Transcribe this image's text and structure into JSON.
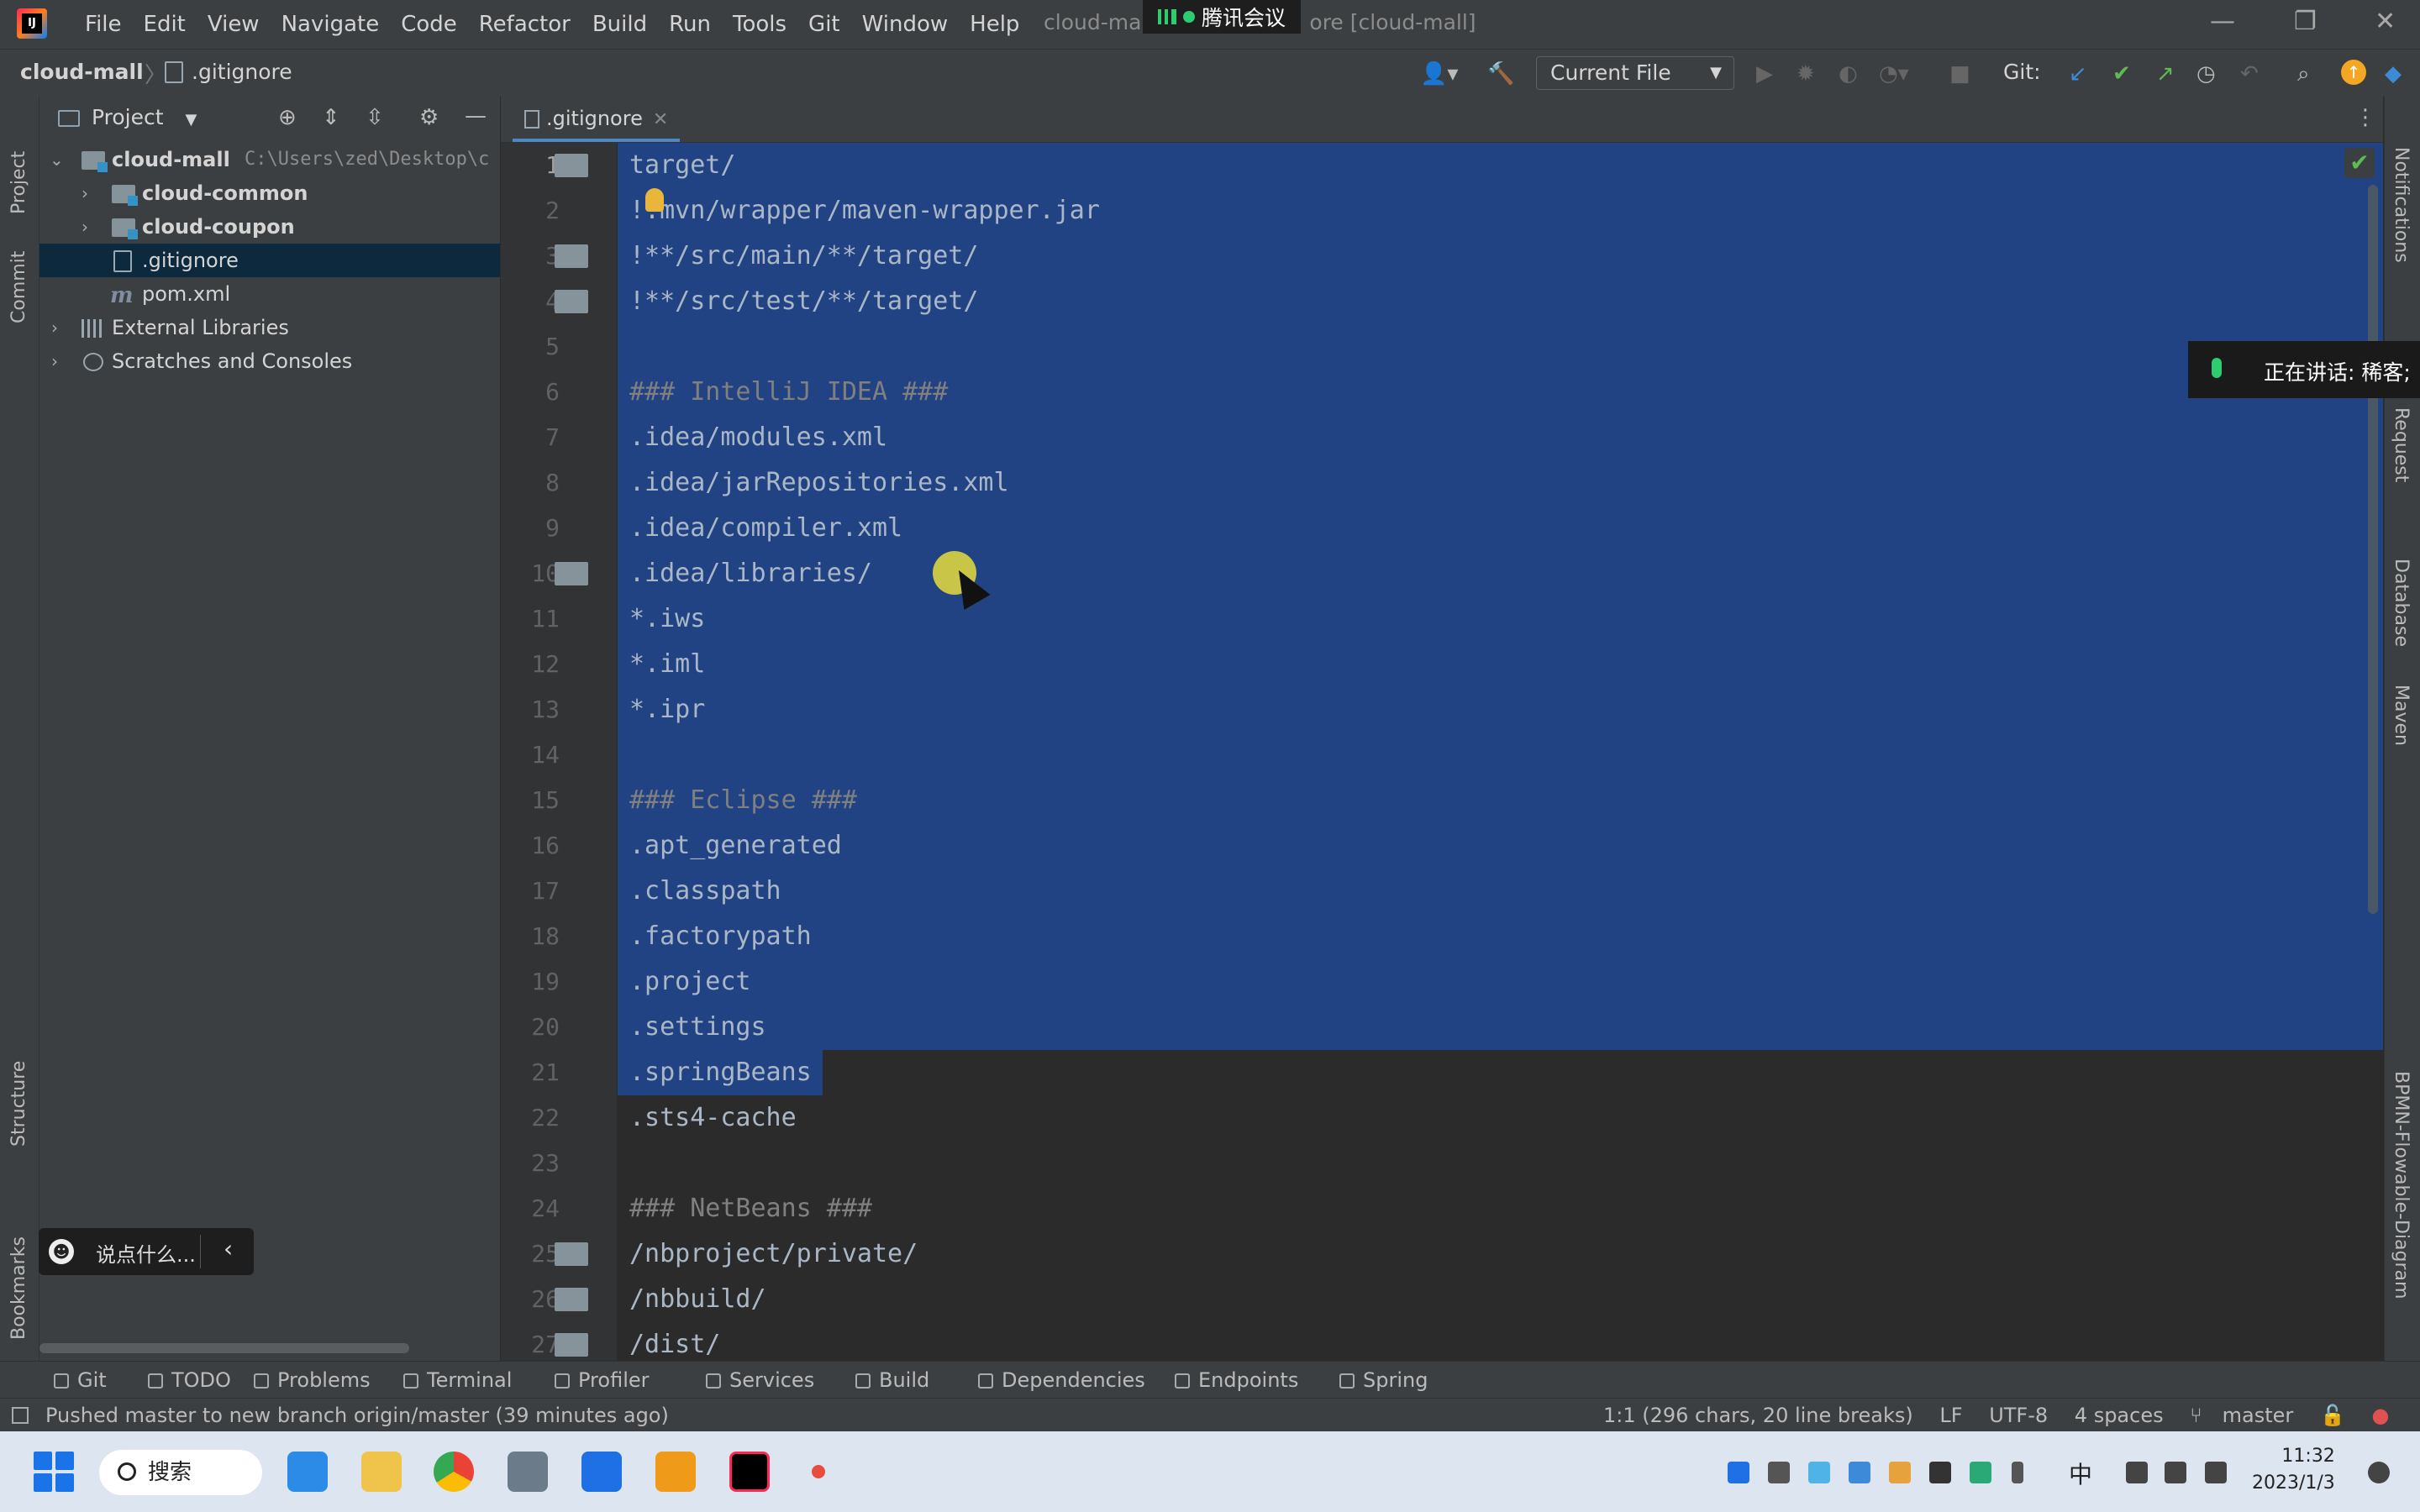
{
  "window": {
    "title": "cloud-ma",
    "title_tail": "ore [cloud-mall]",
    "meeting_label": "腾讯会议",
    "menu": [
      "File",
      "Edit",
      "View",
      "Navigate",
      "Code",
      "Refactor",
      "Build",
      "Run",
      "Tools",
      "Git",
      "Window",
      "Help"
    ]
  },
  "navbar": {
    "project": "cloud-mall",
    "file": ".gitignore",
    "run_config": "Current File",
    "git_label": "Git:"
  },
  "left_strip": [
    "Project",
    "Commit",
    "Structure",
    "Bookmarks"
  ],
  "right_strip": [
    "Notifications",
    "Request",
    "Database",
    "Maven",
    "BPMN-Flowable-Diagram"
  ],
  "project_panel": {
    "title": "Project",
    "tree": [
      {
        "label": "cloud-mall",
        "extra": "C:\\Users\\zed\\Desktop\\c",
        "type": "module",
        "expanded": true
      },
      {
        "label": "cloud-common",
        "type": "module",
        "expanded": false
      },
      {
        "label": "cloud-coupon",
        "type": "module",
        "expanded": false
      },
      {
        "label": ".gitignore",
        "type": "file",
        "selected": true
      },
      {
        "label": "pom.xml",
        "type": "maven"
      },
      {
        "label": "External Libraries",
        "type": "lib"
      },
      {
        "label": "Scratches and Consoles",
        "type": "scratch"
      }
    ]
  },
  "chat_bubble": {
    "text": "说点什么..."
  },
  "speaking_overlay": {
    "text": "正在讲话: 稀客;"
  },
  "editor": {
    "tab": ".gitignore",
    "lines": [
      {
        "n": "1",
        "text": "target/",
        "fold": true
      },
      {
        "n": "2",
        "text": "!.mvn/wrapper/maven-wrapper.jar"
      },
      {
        "n": "3",
        "text": "!**/src/main/**/target/",
        "fold": true
      },
      {
        "n": "4",
        "text": "!**/src/test/**/target/",
        "fold": true
      },
      {
        "n": "5",
        "text": ""
      },
      {
        "n": "6",
        "text": "### IntelliJ IDEA ###",
        "comment": true
      },
      {
        "n": "7",
        "text": ".idea/modules.xml"
      },
      {
        "n": "8",
        "text": ".idea/jarRepositories.xml"
      },
      {
        "n": "9",
        "text": ".idea/compiler.xml"
      },
      {
        "n": "10",
        "text": ".idea/libraries/",
        "fold": true
      },
      {
        "n": "11",
        "text": "*.iws"
      },
      {
        "n": "12",
        "text": "*.iml"
      },
      {
        "n": "13",
        "text": "*.ipr"
      },
      {
        "n": "14",
        "text": ""
      },
      {
        "n": "15",
        "text": "### Eclipse ###",
        "comment": true
      },
      {
        "n": "16",
        "text": ".apt_generated"
      },
      {
        "n": "17",
        "text": ".classpath"
      },
      {
        "n": "18",
        "text": ".factorypath"
      },
      {
        "n": "19",
        "text": ".project"
      },
      {
        "n": "20",
        "text": ".settings"
      },
      {
        "n": "21",
        "text": ".springBeans"
      },
      {
        "n": "22",
        "text": ".sts4-cache"
      },
      {
        "n": "23",
        "text": ""
      },
      {
        "n": "24",
        "text": "### NetBeans ###",
        "comment": true
      },
      {
        "n": "25",
        "text": "/nbproject/private/",
        "fold": true
      },
      {
        "n": "26",
        "text": "/nbbuild/",
        "fold": true
      },
      {
        "n": "27",
        "text": "/dist/",
        "fold": true
      }
    ]
  },
  "bottom_tabs": [
    "Git",
    "TODO",
    "Problems",
    "Terminal",
    "Profiler",
    "Services",
    "Build",
    "Dependencies",
    "Endpoints",
    "Spring"
  ],
  "status": {
    "message": "Pushed master to new branch origin/master (39 minutes ago)",
    "position": "1:1 (296 chars, 20 line breaks)",
    "line_sep": "LF",
    "encoding": "UTF-8",
    "indent": "4 spaces",
    "branch": "master"
  },
  "taskbar": {
    "search": "搜索",
    "ime": "中",
    "time": "11:32",
    "date": "2023/1/3"
  }
}
